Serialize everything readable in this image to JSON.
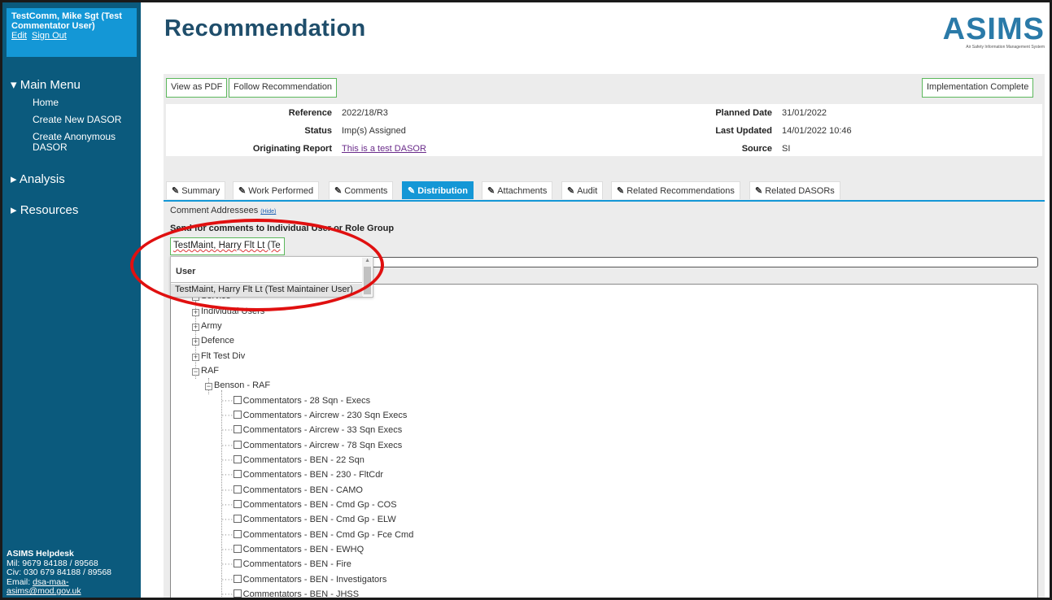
{
  "user": {
    "name": "TestComm, Mike Sgt (Test Commentator User)",
    "edit_label": "Edit",
    "signout_label": "Sign Out"
  },
  "nav": {
    "main_menu": "▾ Main Menu",
    "items": [
      {
        "label": "Home"
      },
      {
        "label": "Create New DASOR"
      },
      {
        "label": "Create Anonymous DASOR"
      }
    ],
    "analysis": "▸ Analysis",
    "resources": "▸ Resources"
  },
  "helpdesk": {
    "title": "ASIMS Helpdesk",
    "mil": "Mil: 9679 84188 / 89568",
    "civ": "Civ: 030 679 84188 / 89568",
    "email_prefix": "Email: ",
    "email_line1": "dsa-maa-",
    "email_line2": "asims@mod.gov.uk"
  },
  "page": {
    "title": "Recommendation"
  },
  "logo": {
    "text": "ASIMS",
    "tagline": "Air Safety Information Management System"
  },
  "toolbar": {
    "view_pdf": "View as PDF",
    "follow": "Follow Recommendation",
    "implementation_complete": "Implementation Complete"
  },
  "info": {
    "reference_label": "Reference",
    "reference": "2022/18/R3",
    "status_label": "Status",
    "status": "Imp(s) Assigned",
    "orig_label": "Originating Report",
    "orig": "This is a test DASOR",
    "planned_label": "Planned Date",
    "planned": "31/01/2022",
    "updated_label": "Last Updated",
    "updated": "14/01/2022 10:46",
    "source_label": "Source",
    "source": "SI"
  },
  "tabs": [
    {
      "label": "Summary"
    },
    {
      "label": "Work Performed"
    },
    {
      "label": "Comments"
    },
    {
      "label": "Distribution"
    },
    {
      "label": "Attachments"
    },
    {
      "label": "Audit"
    },
    {
      "label": "Related Recommendations"
    },
    {
      "label": "Related DASORs"
    }
  ],
  "distribution": {
    "comment_addressees": "Comment Addressees",
    "hide": "(Hide)",
    "send_label": "Send for comments to Individual User or Role Group",
    "search_value": "TestMaint, Harry Flt Lt (Te",
    "dropdown_header": "User",
    "dropdown_option": "TestMaint, Harry Flt Lt (Test Maintainer User)"
  },
  "tree": {
    "service": "Service",
    "individual_users": "Individual Users",
    "army": "Army",
    "defence": "Defence",
    "flt_test_div": "Flt Test Div",
    "raf": "RAF",
    "benson": "Benson - RAF",
    "leaves": [
      "Commentators - 28 Sqn - Execs",
      "Commentators - Aircrew - 230 Sqn Execs",
      "Commentators - Aircrew - 33 Sqn Execs",
      "Commentators - Aircrew - 78 Sqn Execs",
      "Commentators - BEN - 22 Sqn",
      "Commentators - BEN - 230 - FltCdr",
      "Commentators - BEN - CAMO",
      "Commentators - BEN - Cmd Gp - COS",
      "Commentators - BEN - Cmd Gp - ELW",
      "Commentators - BEN - Cmd Gp - Fce Cmd",
      "Commentators - BEN - EWHQ",
      "Commentators - BEN - Fire",
      "Commentators - BEN - Investigators",
      "Commentators - BEN - JHSS"
    ]
  },
  "colors": {
    "sidebar": "#0b5a7d",
    "accent": "#1497d6",
    "title": "#1f4e6b",
    "button_border": "#5cb85c",
    "annotation": "#e01010"
  }
}
